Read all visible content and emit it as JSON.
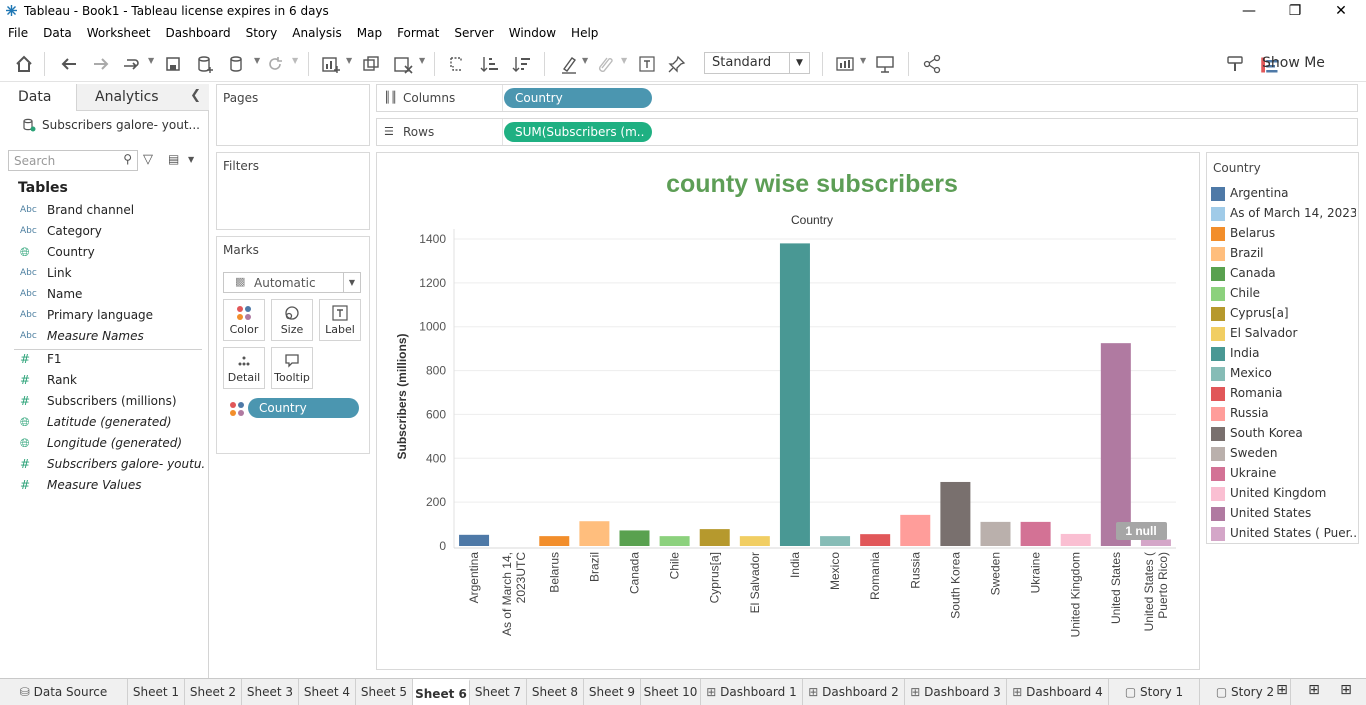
{
  "window": {
    "title": "Tableau - Book1 - Tableau license expires in 6 days"
  },
  "menu": [
    "File",
    "Data",
    "Worksheet",
    "Dashboard",
    "Story",
    "Analysis",
    "Map",
    "Format",
    "Server",
    "Window",
    "Help"
  ],
  "toolbar": {
    "fit_value": "Standard",
    "show_me_label": "Show Me"
  },
  "data_pane": {
    "tab_data": "Data",
    "tab_analytics": "Analytics",
    "source": "Subscribers galore- yout...",
    "search_placeholder": "Search",
    "tables_header": "Tables",
    "dimensions": [
      {
        "type": "Abc",
        "name": "Brand channel"
      },
      {
        "type": "Abc",
        "name": "Category"
      },
      {
        "type": "geo",
        "name": "Country"
      },
      {
        "type": "Abc",
        "name": "Link"
      },
      {
        "type": "Abc",
        "name": "Name"
      },
      {
        "type": "Abc",
        "name": "Primary language"
      },
      {
        "type": "Abc",
        "name": "Measure Names"
      }
    ],
    "measures": [
      {
        "type": "#",
        "name": "F1"
      },
      {
        "type": "#",
        "name": "Rank"
      },
      {
        "type": "#",
        "name": "Subscribers (millions)"
      },
      {
        "type": "geo",
        "name": "Latitude (generated)"
      },
      {
        "type": "geo",
        "name": "Longitude (generated)"
      },
      {
        "type": "#",
        "name": "Subscribers galore- youtu..."
      },
      {
        "type": "#",
        "name": "Measure Values"
      }
    ]
  },
  "cards": {
    "pages": "Pages",
    "filters": "Filters",
    "marks": "Marks",
    "mark_type": "Automatic",
    "mark_buttons": [
      "Color",
      "Size",
      "Label",
      "Detail",
      "Tooltip"
    ],
    "marks_pill": "Country"
  },
  "shelves": {
    "columns_label": "Columns",
    "columns_pill": "Country",
    "rows_label": "Rows",
    "rows_pill": "SUM(Subscribers (m.."
  },
  "chart_data": {
    "type": "bar",
    "title": "county wise subscribers",
    "header": "Country",
    "ylabel": "Subscribers (millions)",
    "ylim": [
      0,
      1400
    ],
    "yticks": [
      0,
      200,
      400,
      600,
      800,
      1000,
      1200,
      1400
    ],
    "null_indicator": "1 null",
    "categories": [
      "Argentina",
      "As of March 14, 2023UTC",
      "Belarus",
      "Brazil",
      "Canada",
      "Chile",
      "Cyprus[a]",
      "El Salvador",
      "India",
      "Mexico",
      "Romania",
      "Russia",
      "South Korea",
      "Sweden",
      "Ukraine",
      "United Kingdom",
      "United States",
      "United States ( Puerto Rico)"
    ],
    "category_axis_labels": [
      [
        "Argentina"
      ],
      [
        "As of March 14,",
        "2023UTC"
      ],
      [
        "Belarus"
      ],
      [
        "Brazil"
      ],
      [
        "Canada"
      ],
      [
        "Chile"
      ],
      [
        "Cyprus[a]"
      ],
      [
        "El Salvador"
      ],
      [
        "India"
      ],
      [
        "Mexico"
      ],
      [
        "Romania"
      ],
      [
        "Russia"
      ],
      [
        "South Korea"
      ],
      [
        "Sweden"
      ],
      [
        "Ukraine"
      ],
      [
        "United Kingdom"
      ],
      [
        "United States"
      ],
      [
        "United States (",
        "Puerto Rico)"
      ]
    ],
    "values": [
      51,
      null,
      45,
      113,
      71,
      45,
      77,
      45,
      1380,
      45,
      54,
      142,
      292,
      110,
      110,
      55,
      925,
      30
    ],
    "colors": [
      "#4e79a7",
      "#a0cbe8",
      "#f28e2b",
      "#ffbe7d",
      "#59a14f",
      "#8cd17d",
      "#b6992d",
      "#f1ce63",
      "#499894",
      "#86bcb6",
      "#e15759",
      "#ff9d9a",
      "#79706e",
      "#bab0ac",
      "#d37295",
      "#fabfd2",
      "#b07aa1",
      "#d4a6c8"
    ]
  },
  "legend": {
    "title": "Country",
    "items": [
      "Argentina",
      "As of March 14, 2023...",
      "Belarus",
      "Brazil",
      "Canada",
      "Chile",
      "Cyprus[a]",
      "El Salvador",
      "India",
      "Mexico",
      "Romania",
      "Russia",
      "South Korea",
      "Sweden",
      "Ukraine",
      "United Kingdom",
      "United States",
      "United States ( Puer..."
    ]
  },
  "bottom_tabs": [
    "Data Source",
    "Sheet 1",
    "Sheet 2",
    "Sheet 3",
    "Sheet 4",
    "Sheet 5",
    "Sheet 6",
    "Sheet 7",
    "Sheet 8",
    "Sheet 9",
    "Sheet 10",
    "Dashboard 1",
    "Dashboard 2",
    "Dashboard 3",
    "Dashboard 4",
    "Story 1",
    "Story 2"
  ],
  "active_tab": "Sheet 6"
}
